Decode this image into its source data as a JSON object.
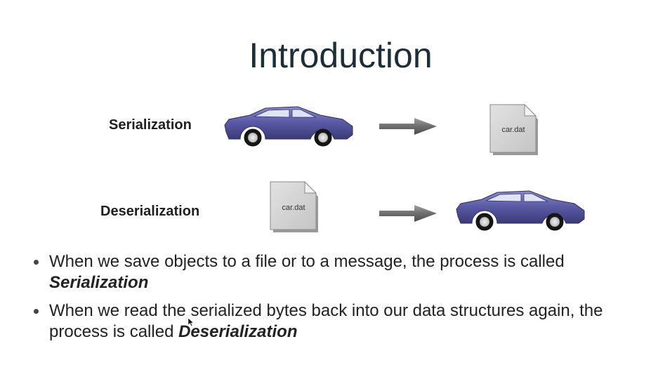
{
  "title": "Introduction",
  "rows": {
    "serialization": {
      "label": "Serialization",
      "file_label": "car.dat"
    },
    "deserialization": {
      "label": "Deserialization",
      "file_label": "car.dat"
    }
  },
  "bullets": [
    {
      "text": "When we save objects to a file or to a message, the process is called",
      "emphasis": "Serialization"
    },
    {
      "text": "When we read the serialized bytes back into our data structures again, the process is called",
      "emphasis": "Deserialization"
    }
  ],
  "colors": {
    "car_body": "#5a5aa0",
    "arrow": "#7a7a7a",
    "file": "#d2d2d2",
    "title": "#1e2e38"
  },
  "icons": [
    "car-icon",
    "arrow-right-icon",
    "file-icon"
  ]
}
